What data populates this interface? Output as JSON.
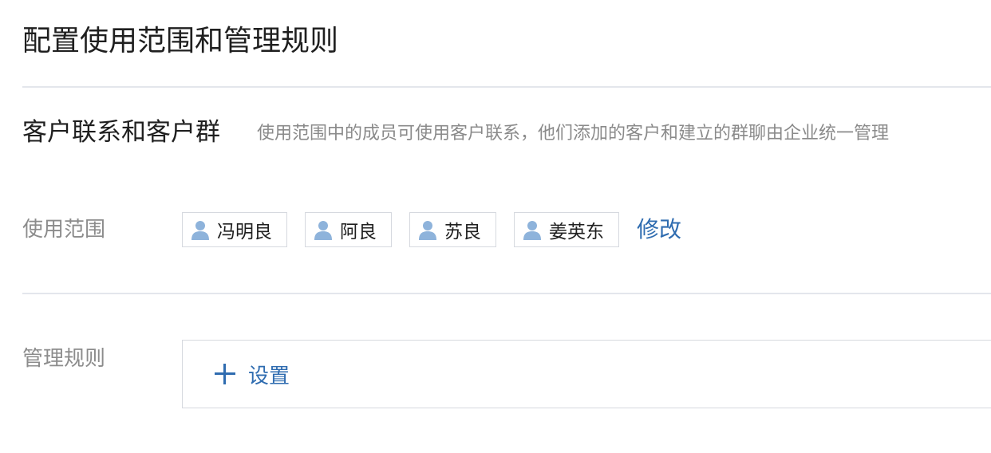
{
  "page": {
    "title": "配置使用范围和管理规则"
  },
  "section": {
    "title": "客户联系和客户群",
    "description": "使用范围中的成员可使用客户联系，他们添加的客户和建立的群聊由企业统一管理"
  },
  "scope": {
    "label": "使用范围",
    "members": [
      {
        "name": "冯明良",
        "icon": "user-icon"
      },
      {
        "name": "阿良",
        "icon": "user-icon"
      },
      {
        "name": "苏良",
        "icon": "user-icon"
      },
      {
        "name": "姜英东",
        "icon": "user-icon"
      }
    ],
    "modify_label": "修改"
  },
  "rules": {
    "label": "管理规则",
    "setting_label": "设置",
    "setting_icon": "plus-icon"
  },
  "colors": {
    "link": "#2f6cb0",
    "user_icon": "#8eb3db",
    "divider": "#e3e6ec",
    "muted_text": "#8c8c8c"
  }
}
